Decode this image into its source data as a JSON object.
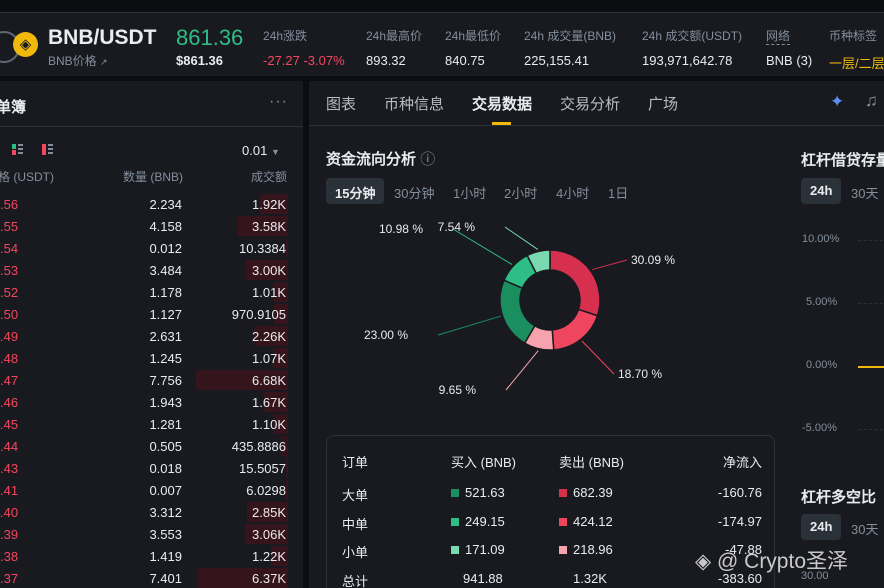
{
  "header": {
    "pair": "BNB/USDT",
    "sub": "BNB价格",
    "sub_arrow": "↗",
    "price": "861.36",
    "price_usd": "$861.36",
    "stats": [
      {
        "label": "24h涨跌",
        "value": "-27.27 -3.07%"
      },
      {
        "label": "24h最高价",
        "value": "893.32"
      },
      {
        "label": "24h最低价",
        "value": "840.75"
      },
      {
        "label": "24h 成交量(BNB)",
        "value": "225,155.41"
      },
      {
        "label": "24h 成交额(USDT)",
        "value": "193,971,642.78"
      },
      {
        "label": "网络",
        "value": "BNB (3)"
      },
      {
        "label": "币种标签",
        "value": "一层/二层"
      }
    ]
  },
  "orderbook": {
    "title": "单簿",
    "menu": "···",
    "precision": "0.01",
    "cols": [
      "格 (USDT)",
      "数量 (BNB)",
      "成交额"
    ],
    "rows": [
      {
        "p": ".56",
        "q": "2.234",
        "t": "1.92K",
        "d": 0.2
      },
      {
        "p": ".55",
        "q": "4.158",
        "t": "3.58K",
        "d": 0.36
      },
      {
        "p": ".54",
        "q": "0.012",
        "t": "10.3384",
        "d": 0.01
      },
      {
        "p": ".53",
        "q": "3.484",
        "t": "3.00K",
        "d": 0.3
      },
      {
        "p": ".52",
        "q": "1.178",
        "t": "1.01K",
        "d": 0.1
      },
      {
        "p": ".50",
        "q": "1.127",
        "t": "970.9105",
        "d": 0.1
      },
      {
        "p": ".49",
        "q": "2.631",
        "t": "2.26K",
        "d": 0.24
      },
      {
        "p": ".48",
        "q": "1.245",
        "t": "1.07K",
        "d": 0.11
      },
      {
        "p": ".47",
        "q": "7.756",
        "t": "6.68K",
        "d": 0.66
      },
      {
        "p": ".46",
        "q": "1.943",
        "t": "1.67K",
        "d": 0.17
      },
      {
        "p": ".45",
        "q": "1.281",
        "t": "1.10K",
        "d": 0.11
      },
      {
        "p": ".44",
        "q": "0.505",
        "t": "435.8886",
        "d": 0.05
      },
      {
        "p": ".43",
        "q": "0.018",
        "t": "15.5057",
        "d": 0.01
      },
      {
        "p": ".41",
        "q": "0.007",
        "t": "6.0298",
        "d": 0.01
      },
      {
        "p": ".40",
        "q": "3.312",
        "t": "2.85K",
        "d": 0.29
      },
      {
        "p": ".39",
        "q": "3.553",
        "t": "3.06K",
        "d": 0.31
      },
      {
        "p": ".38",
        "q": "1.419",
        "t": "1.22K",
        "d": 0.12
      },
      {
        "p": ".37",
        "q": "7.401",
        "t": "6.37K",
        "d": 0.64
      }
    ]
  },
  "tabs": [
    "图表",
    "币种信息",
    "交易数据",
    "交易分析",
    "广场"
  ],
  "flow": {
    "title": "资金流向分析",
    "info": "ⓘ",
    "periods": [
      "15分钟",
      "30分钟",
      "1小时",
      "2小时",
      "4小时",
      "1日"
    ]
  },
  "chart_data": {
    "type": "pie",
    "categories": [
      "卖出大单",
      "卖出中单",
      "卖出小单",
      "买入小单",
      "买入中单",
      "买入大单"
    ],
    "values": [
      30.09,
      18.7,
      9.65,
      23.0,
      10.98,
      7.54
    ],
    "labels": [
      "30.09 %",
      "18.70 %",
      "9.65 %",
      "23.00 %",
      "10.98 %",
      "7.54 %"
    ],
    "colors": [
      "#d72f4e",
      "#f0455e",
      "#f7a3ad",
      "#1a8e5f",
      "#2ebd85",
      "#7ad9b1"
    ]
  },
  "table": {
    "headers": [
      "订单",
      "买入 (BNB)",
      "卖出 (BNB)",
      "净流入"
    ],
    "rows": [
      {
        "name": "大单",
        "buy": "521.63",
        "sell": "682.39",
        "net": "-160.76",
        "bc": "#1a8e5f",
        "sc": "#d72f4e"
      },
      {
        "name": "中单",
        "buy": "249.15",
        "sell": "424.12",
        "net": "-174.97",
        "bc": "#2ebd85",
        "sc": "#f0455e"
      },
      {
        "name": "小单",
        "buy": "171.09",
        "sell": "218.96",
        "net": "-47.88",
        "bc": "#7ad9b1",
        "sc": "#f7a3ad"
      },
      {
        "name": "总计",
        "buy": "941.88",
        "sell": "1.32K",
        "net": "-383.60"
      }
    ]
  },
  "margin": {
    "title": "杠杆借贷存量",
    "periods": [
      "24h",
      "30天"
    ],
    "ticks": [
      "10.00%",
      "5.00%",
      "0.00%",
      "-5.00%"
    ],
    "title2": "杠杆多空比",
    "periods2": [
      "24h",
      "30天"
    ],
    "tick2": "30.00"
  },
  "watermark": "@ Crypto圣泽",
  "colors": {
    "up": "#2ebd85",
    "down": "#f6465d",
    "accent": "#f0b90b"
  }
}
